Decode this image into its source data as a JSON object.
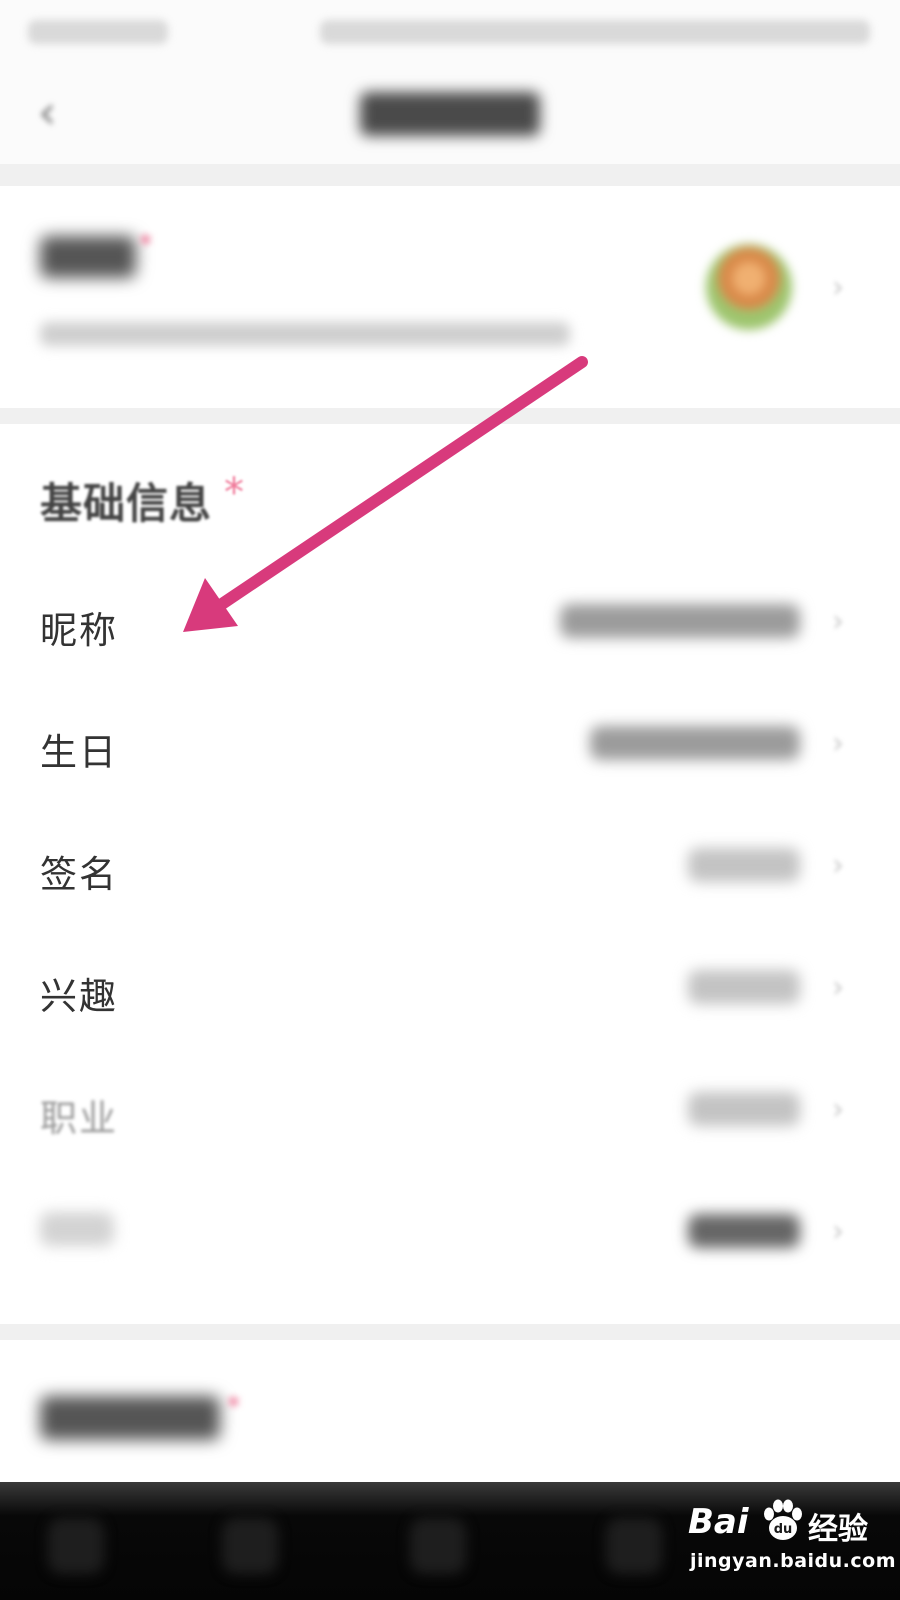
{
  "header": {
    "back_icon": "chevron-left-icon"
  },
  "basic_info": {
    "title": "基础信息",
    "required_mark": "*",
    "rows": [
      {
        "label": "昵称"
      },
      {
        "label": "生日"
      },
      {
        "label": "签名"
      },
      {
        "label": "兴趣"
      },
      {
        "label": "职业"
      }
    ]
  },
  "avatar_section": {
    "required_mark": "*"
  },
  "bottom_section": {
    "required_mark": "*"
  },
  "annotation": {
    "type": "arrow",
    "color": "#d83a7c",
    "points_to": "昵称"
  },
  "watermark": {
    "brand": "Bai",
    "suffix": "经验",
    "url": "jingyan.baidu.com"
  },
  "colors": {
    "accent_star": "#f07a9a",
    "arrow": "#d83a7c"
  }
}
